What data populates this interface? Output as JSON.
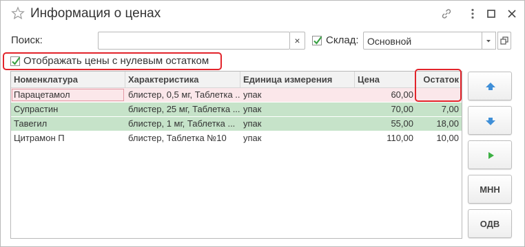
{
  "window": {
    "title": "Информация о ценах"
  },
  "filters": {
    "search_label": "Поиск:",
    "search_value": "",
    "clear_glyph": "×",
    "warehouse_checked": true,
    "warehouse_label": "Склад:",
    "warehouse_value": "Основной",
    "show_zero_checked": true,
    "show_zero_label": "Отображать цены с нулевым остатком"
  },
  "table": {
    "columns": [
      "Номенклатура",
      "Характеристика",
      "Единица измерения",
      "Цена",
      "Остаток"
    ],
    "rows": [
      {
        "name": "Парацетамол",
        "characteristic": "блистер, 0,5 мг, Таблетка ...",
        "unit": "упак",
        "price": "60,00",
        "stock": "",
        "style": "pink"
      },
      {
        "name": "Супрастин",
        "characteristic": "блистер, 25 мг, Таблетка ...",
        "unit": "упак",
        "price": "70,00",
        "stock": "7,00",
        "style": "green"
      },
      {
        "name": "Тавегил",
        "characteristic": "блистер, 1 мг, Таблетка ...",
        "unit": "упак",
        "price": "55,00",
        "stock": "18,00",
        "style": "green"
      },
      {
        "name": "Цитрамон П",
        "characteristic": "блистер, Таблетка №10",
        "unit": "упак",
        "price": "110,00",
        "stock": "10,00",
        "style": "white"
      }
    ]
  },
  "side_buttons": {
    "up_icon": "arrow-up-icon",
    "down_icon": "arrow-down-icon",
    "run_icon": "play-icon",
    "mnn_label": "МНН",
    "odv_label": "ОДВ"
  },
  "colors": {
    "highlight_frame": "#e2232a",
    "row_pink": "#fbe7ea",
    "row_green": "#c6e3c9",
    "checkbox_green": "#3aa144",
    "arrow_blue": "#3f8fd8",
    "play_green": "#3cb043"
  }
}
